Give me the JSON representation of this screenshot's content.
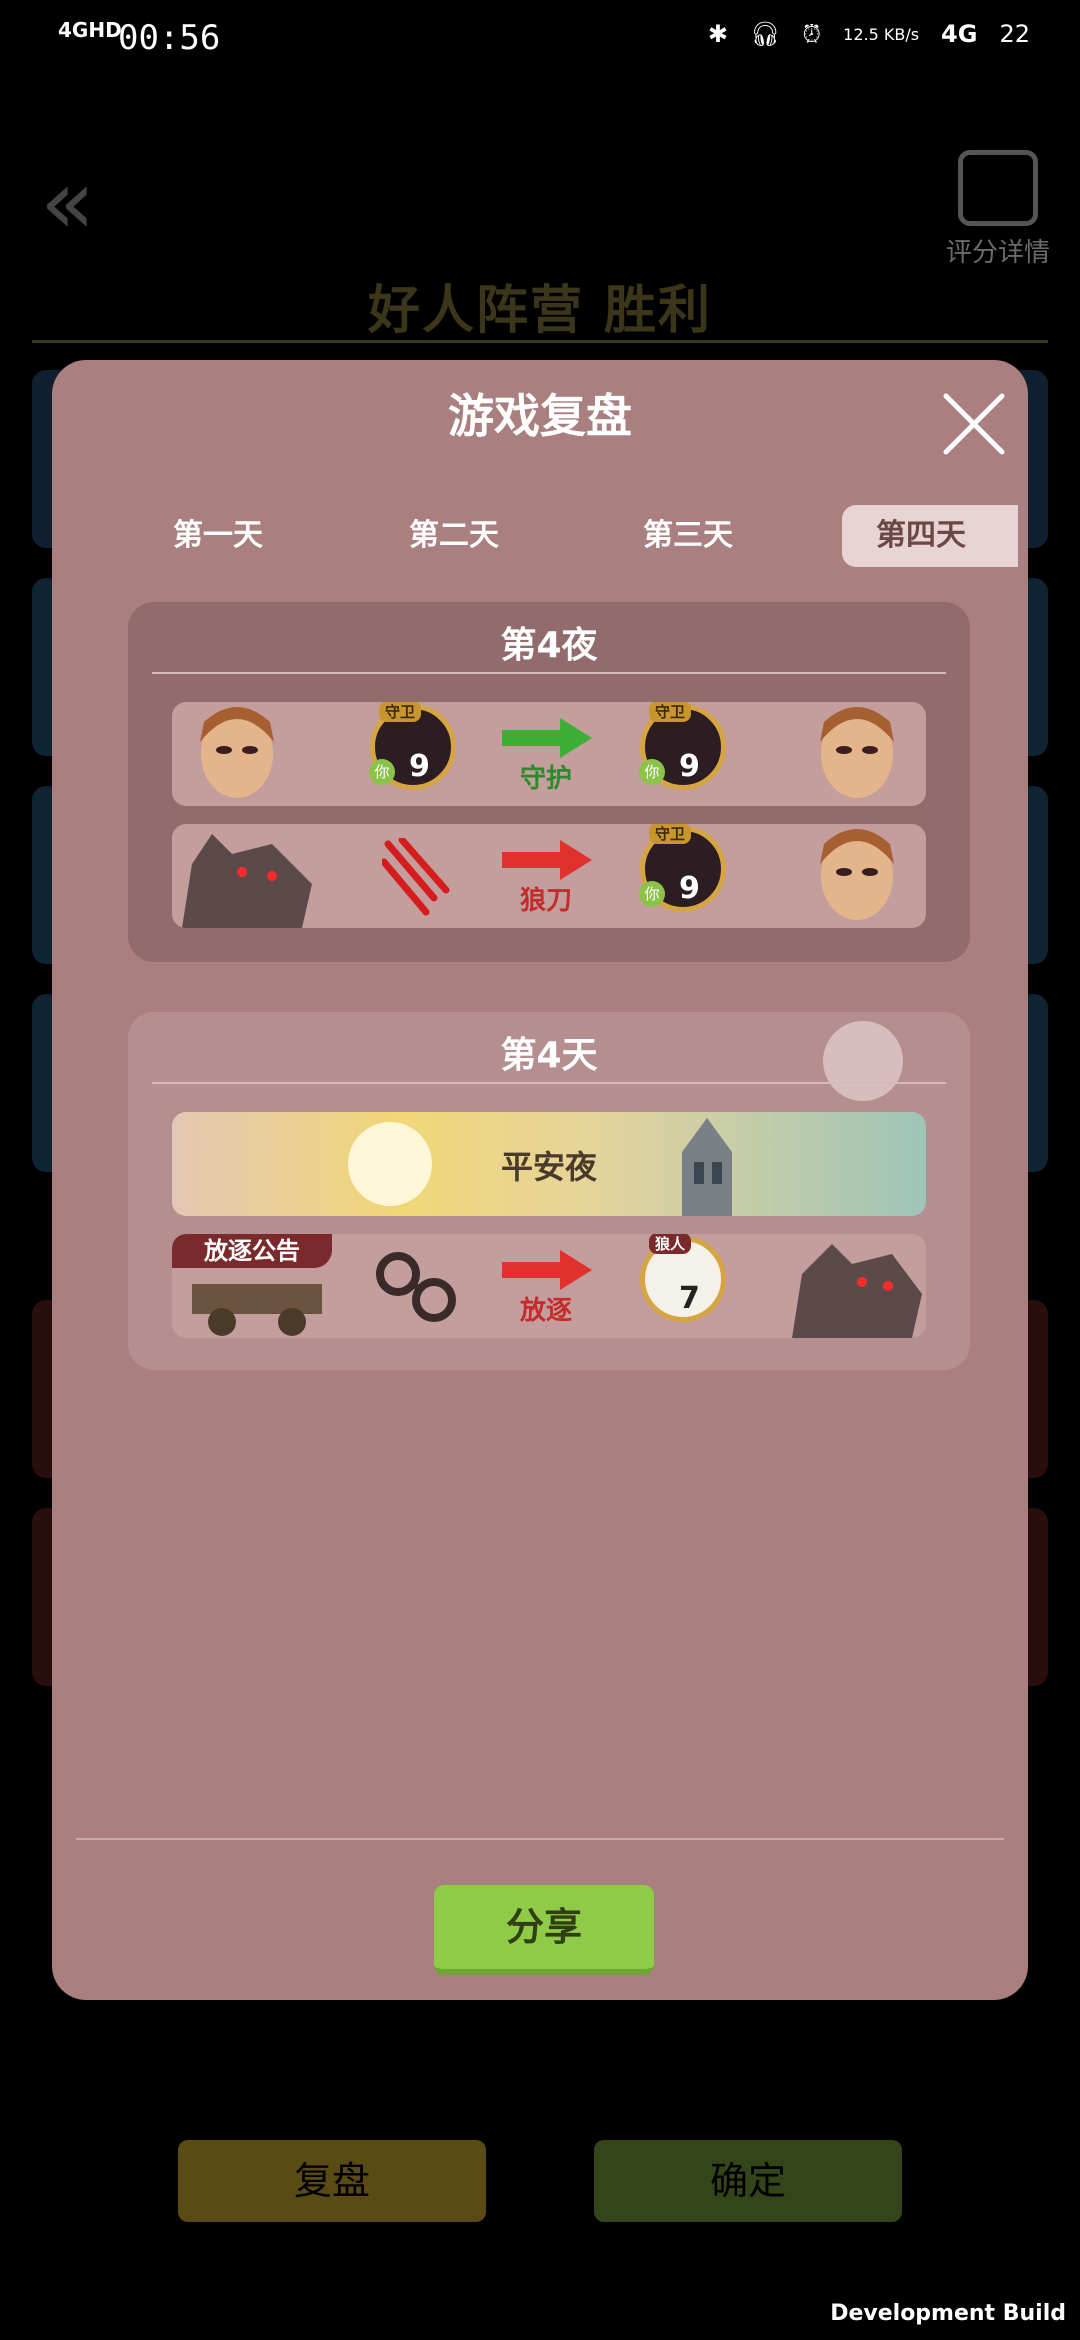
{
  "status_bar": {
    "network": "4GHD",
    "time": "00:56",
    "speed": "12.5 KB/s",
    "net_type": "4G",
    "battery": "22"
  },
  "background": {
    "result_title": "好人阵营  胜利",
    "score_detail_label": "评分详情",
    "replay_button": "复盘",
    "confirm_button": "确定",
    "dev_build": "Development Build"
  },
  "modal": {
    "title": "游戏复盘",
    "tabs": [
      {
        "label": "第一天"
      },
      {
        "label": "第二天"
      },
      {
        "label": "第三天"
      },
      {
        "label": "第四天",
        "active": true
      }
    ],
    "night": {
      "title": "第4夜",
      "events": [
        {
          "action": "守护",
          "target_role": "守卫",
          "target_number": "9",
          "you_badge": "你",
          "source_role": "守卫",
          "source_number": "9",
          "arrow_color": "#3fae35"
        },
        {
          "action": "狼刀",
          "target_role": "守卫",
          "target_number": "9",
          "you_badge": "你",
          "arrow_color": "#e0312e"
        }
      ]
    },
    "day": {
      "title": "第4天",
      "peaceful_label": "平安夜",
      "exile_banner": "放逐公告",
      "exile_action": "放逐",
      "exile_role": "狼人",
      "exile_number": "7",
      "arrow_color": "#e0312e"
    },
    "share_button": "分享"
  },
  "colors": {
    "modal_bg": "#a97f80",
    "share_green": "#8fcb46",
    "replay_gold": "#5a4a14",
    "confirm_green": "#34451a"
  }
}
